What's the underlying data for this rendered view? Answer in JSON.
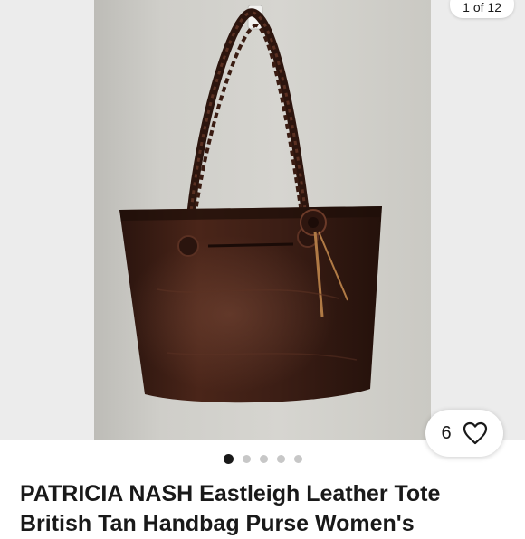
{
  "gallery": {
    "counter": "1 of 12",
    "pagination_total": 5,
    "pagination_active": 0
  },
  "photo": {
    "subject": "brown leather tote bag",
    "bag_color": "#3a1d14",
    "wall_color": "#d2d1cc"
  },
  "watch": {
    "count": "6",
    "icon": "heart-icon"
  },
  "listing": {
    "title": "PATRICIA NASH Eastleigh Leather Tote British Tan Handbag Purse Women's"
  }
}
